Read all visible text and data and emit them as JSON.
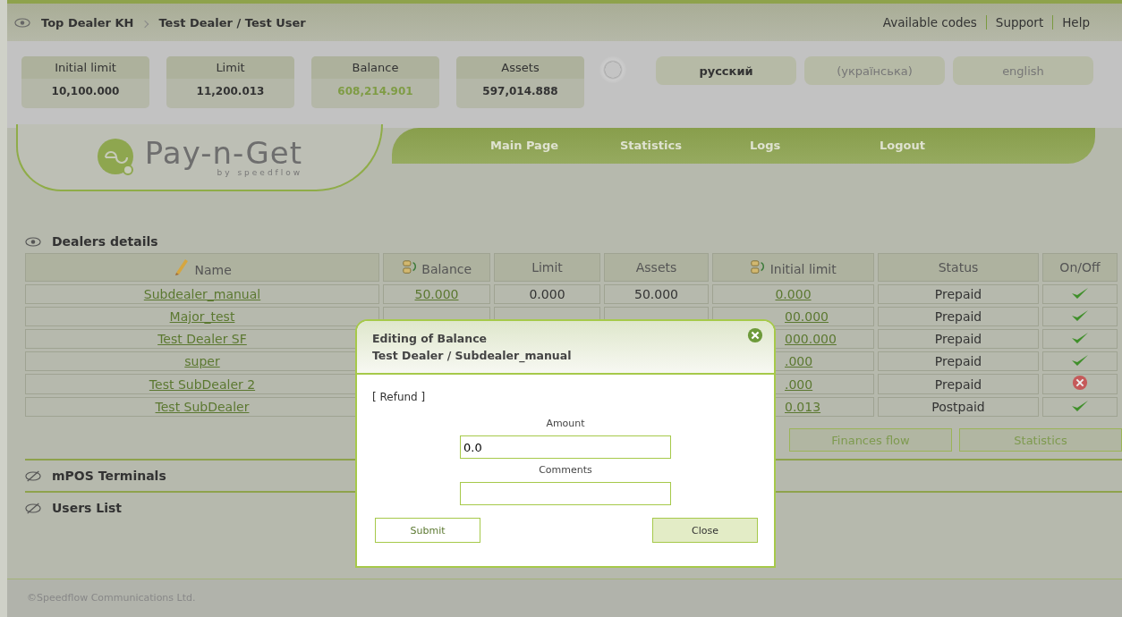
{
  "breadcrumb": [
    "Top Dealer KH",
    "Test Dealer / Test User"
  ],
  "top_links": [
    "Available codes",
    "Support",
    "Help"
  ],
  "stats": [
    {
      "label": "Initial limit",
      "value": "10,100.000",
      "highlight": false
    },
    {
      "label": "Limit",
      "value": "11,200.013",
      "highlight": false
    },
    {
      "label": "Balance",
      "value": "608,214.901",
      "highlight": true
    },
    {
      "label": "Assets",
      "value": "597,014.888",
      "highlight": false
    }
  ],
  "languages": [
    {
      "label": "русский",
      "selected": true
    },
    {
      "label": "(українська)",
      "selected": false
    },
    {
      "label": "english",
      "selected": false
    }
  ],
  "logo": {
    "name": "Pay-n-Get",
    "tagline": "by speedflow"
  },
  "nav": [
    "Main Page",
    "Statistics",
    "Logs",
    "Logout"
  ],
  "dealers": {
    "title": "Dealers details",
    "expanded": true,
    "columns": [
      {
        "label": "Name"
      },
      {
        "label": "Balance"
      },
      {
        "label": "Limit"
      },
      {
        "label": "Assets"
      },
      {
        "label": "Initial limit"
      },
      {
        "label": "Status"
      },
      {
        "label": "On/Off"
      }
    ],
    "rows": [
      {
        "name": "Subdealer_manual",
        "balance": "50.000",
        "limit": "0.000",
        "assets": "50.000",
        "initial_limit": "0.000",
        "covered": false,
        "status": "Prepaid",
        "on": true
      },
      {
        "name": "Major_test",
        "initial_limit": "00.000",
        "covered": true,
        "status": "Prepaid",
        "on": true
      },
      {
        "name": "Test Dealer SF",
        "initial_limit": "000.000",
        "covered": true,
        "status": "Prepaid",
        "on": true
      },
      {
        "name": "super",
        "initial_limit": ".000",
        "covered": true,
        "status": "Prepaid",
        "on": true
      },
      {
        "name": "Test SubDealer 2",
        "initial_limit": ".000",
        "covered": true,
        "status": "Prepaid",
        "on": false
      },
      {
        "name": "Test SubDealer",
        "initial_limit": "0.013",
        "covered": true,
        "status": "Postpaid",
        "on": true
      }
    ],
    "buttons": [
      "Finances flow",
      "Statistics"
    ]
  },
  "sections": [
    {
      "title": "mPOS Terminals",
      "expanded": false
    },
    {
      "title": "Users List",
      "expanded": false
    }
  ],
  "footer": "©Speedflow Communications Ltd.",
  "dialog": {
    "title": "Editing of Balance",
    "subtitle": "Test Dealer / Subdealer_manual",
    "mode": "[ Refund ]",
    "fields": [
      {
        "label": "Amount",
        "value": "0.0"
      },
      {
        "label": "Comments"
      }
    ],
    "submit": "Submit",
    "close": "Close"
  }
}
